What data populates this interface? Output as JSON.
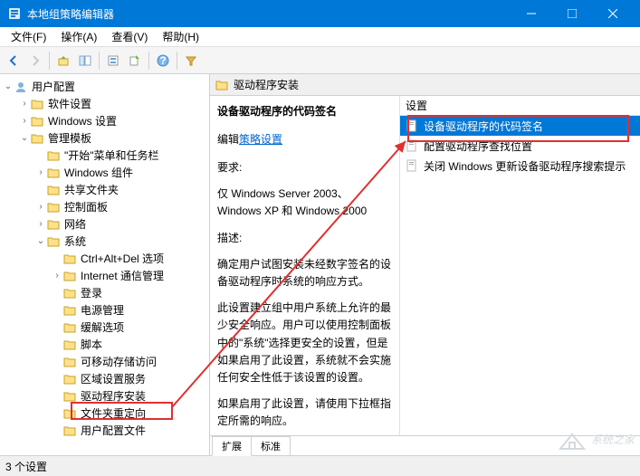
{
  "window": {
    "title": "本地组策略编辑器"
  },
  "menu": {
    "file": "文件(F)",
    "action": "操作(A)",
    "view": "查看(V)",
    "help": "帮助(H)"
  },
  "tree": {
    "root": "用户配置",
    "n1": "软件设置",
    "n2": "Windows 设置",
    "n3": "管理模板",
    "n3a": "\"开始\"菜单和任务栏",
    "n3b": "Windows 组件",
    "n3c": "共享文件夹",
    "n3d": "控制面板",
    "n3e": "网络",
    "n3f": "系统",
    "n3f1": "Ctrl+Alt+Del 选项",
    "n3f2": "Internet 通信管理",
    "n3f3": "登录",
    "n3f4": "电源管理",
    "n3f5": "缓解选项",
    "n3f6": "脚本",
    "n3f7": "可移动存储访问",
    "n3f8": "区域设置服务",
    "n3f9": "驱动程序安装",
    "n3f10": "文件夹重定向",
    "n3f11": "用户配置文件"
  },
  "crumb": {
    "label": "驱动程序安装"
  },
  "detail": {
    "title": "设备驱动程序的代码签名",
    "edit_prefix": "编辑",
    "edit_link": "策略设置",
    "req_label": "要求:",
    "req_text": "仅 Windows Server 2003、Windows XP 和 Windows 2000",
    "desc_label": "描述:",
    "desc1": "确定用户试图安装未经数字签名的设备驱动程序时系统的响应方式。",
    "desc2": "此设置建立组中用户系统上允许的最少安全响应。用户可以使用控制面板中的\"系统\"选择更安全的设置，但是如果启用了此设置，系统就不会实施任何安全性低于该设置的设置。",
    "desc3": "如果启用了此设置，请使用下拉框指定所需的响应。"
  },
  "list": {
    "header": "设置",
    "r0": "设备驱动程序的代码签名",
    "r1": "配置驱动程序查找位置",
    "r2": "关闭 Windows 更新设备驱动程序搜索提示"
  },
  "tabs": {
    "t1": "扩展",
    "t2": "标准"
  },
  "status": {
    "text": "3 个设置"
  },
  "watermark": {
    "text": "系统之家"
  }
}
